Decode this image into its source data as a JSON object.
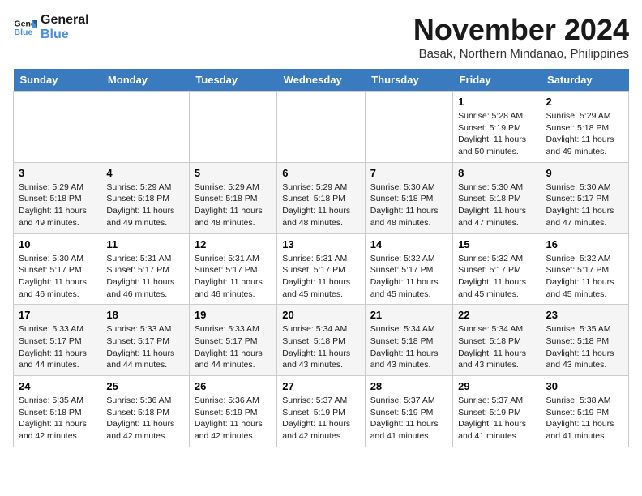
{
  "logo": {
    "line1": "General",
    "line2": "Blue"
  },
  "title": "November 2024",
  "location": "Basak, Northern Mindanao, Philippines",
  "days_of_week": [
    "Sunday",
    "Monday",
    "Tuesday",
    "Wednesday",
    "Thursday",
    "Friday",
    "Saturday"
  ],
  "weeks": [
    [
      {
        "day": "",
        "info": ""
      },
      {
        "day": "",
        "info": ""
      },
      {
        "day": "",
        "info": ""
      },
      {
        "day": "",
        "info": ""
      },
      {
        "day": "",
        "info": ""
      },
      {
        "day": "1",
        "info": "Sunrise: 5:28 AM\nSunset: 5:19 PM\nDaylight: 11 hours and 50 minutes."
      },
      {
        "day": "2",
        "info": "Sunrise: 5:29 AM\nSunset: 5:18 PM\nDaylight: 11 hours and 49 minutes."
      }
    ],
    [
      {
        "day": "3",
        "info": "Sunrise: 5:29 AM\nSunset: 5:18 PM\nDaylight: 11 hours and 49 minutes."
      },
      {
        "day": "4",
        "info": "Sunrise: 5:29 AM\nSunset: 5:18 PM\nDaylight: 11 hours and 49 minutes."
      },
      {
        "day": "5",
        "info": "Sunrise: 5:29 AM\nSunset: 5:18 PM\nDaylight: 11 hours and 48 minutes."
      },
      {
        "day": "6",
        "info": "Sunrise: 5:29 AM\nSunset: 5:18 PM\nDaylight: 11 hours and 48 minutes."
      },
      {
        "day": "7",
        "info": "Sunrise: 5:30 AM\nSunset: 5:18 PM\nDaylight: 11 hours and 48 minutes."
      },
      {
        "day": "8",
        "info": "Sunrise: 5:30 AM\nSunset: 5:18 PM\nDaylight: 11 hours and 47 minutes."
      },
      {
        "day": "9",
        "info": "Sunrise: 5:30 AM\nSunset: 5:17 PM\nDaylight: 11 hours and 47 minutes."
      }
    ],
    [
      {
        "day": "10",
        "info": "Sunrise: 5:30 AM\nSunset: 5:17 PM\nDaylight: 11 hours and 46 minutes."
      },
      {
        "day": "11",
        "info": "Sunrise: 5:31 AM\nSunset: 5:17 PM\nDaylight: 11 hours and 46 minutes."
      },
      {
        "day": "12",
        "info": "Sunrise: 5:31 AM\nSunset: 5:17 PM\nDaylight: 11 hours and 46 minutes."
      },
      {
        "day": "13",
        "info": "Sunrise: 5:31 AM\nSunset: 5:17 PM\nDaylight: 11 hours and 45 minutes."
      },
      {
        "day": "14",
        "info": "Sunrise: 5:32 AM\nSunset: 5:17 PM\nDaylight: 11 hours and 45 minutes."
      },
      {
        "day": "15",
        "info": "Sunrise: 5:32 AM\nSunset: 5:17 PM\nDaylight: 11 hours and 45 minutes."
      },
      {
        "day": "16",
        "info": "Sunrise: 5:32 AM\nSunset: 5:17 PM\nDaylight: 11 hours and 45 minutes."
      }
    ],
    [
      {
        "day": "17",
        "info": "Sunrise: 5:33 AM\nSunset: 5:17 PM\nDaylight: 11 hours and 44 minutes."
      },
      {
        "day": "18",
        "info": "Sunrise: 5:33 AM\nSunset: 5:17 PM\nDaylight: 11 hours and 44 minutes."
      },
      {
        "day": "19",
        "info": "Sunrise: 5:33 AM\nSunset: 5:17 PM\nDaylight: 11 hours and 44 minutes."
      },
      {
        "day": "20",
        "info": "Sunrise: 5:34 AM\nSunset: 5:18 PM\nDaylight: 11 hours and 43 minutes."
      },
      {
        "day": "21",
        "info": "Sunrise: 5:34 AM\nSunset: 5:18 PM\nDaylight: 11 hours and 43 minutes."
      },
      {
        "day": "22",
        "info": "Sunrise: 5:34 AM\nSunset: 5:18 PM\nDaylight: 11 hours and 43 minutes."
      },
      {
        "day": "23",
        "info": "Sunrise: 5:35 AM\nSunset: 5:18 PM\nDaylight: 11 hours and 43 minutes."
      }
    ],
    [
      {
        "day": "24",
        "info": "Sunrise: 5:35 AM\nSunset: 5:18 PM\nDaylight: 11 hours and 42 minutes."
      },
      {
        "day": "25",
        "info": "Sunrise: 5:36 AM\nSunset: 5:18 PM\nDaylight: 11 hours and 42 minutes."
      },
      {
        "day": "26",
        "info": "Sunrise: 5:36 AM\nSunset: 5:19 PM\nDaylight: 11 hours and 42 minutes."
      },
      {
        "day": "27",
        "info": "Sunrise: 5:37 AM\nSunset: 5:19 PM\nDaylight: 11 hours and 42 minutes."
      },
      {
        "day": "28",
        "info": "Sunrise: 5:37 AM\nSunset: 5:19 PM\nDaylight: 11 hours and 41 minutes."
      },
      {
        "day": "29",
        "info": "Sunrise: 5:37 AM\nSunset: 5:19 PM\nDaylight: 11 hours and 41 minutes."
      },
      {
        "day": "30",
        "info": "Sunrise: 5:38 AM\nSunset: 5:19 PM\nDaylight: 11 hours and 41 minutes."
      }
    ]
  ]
}
